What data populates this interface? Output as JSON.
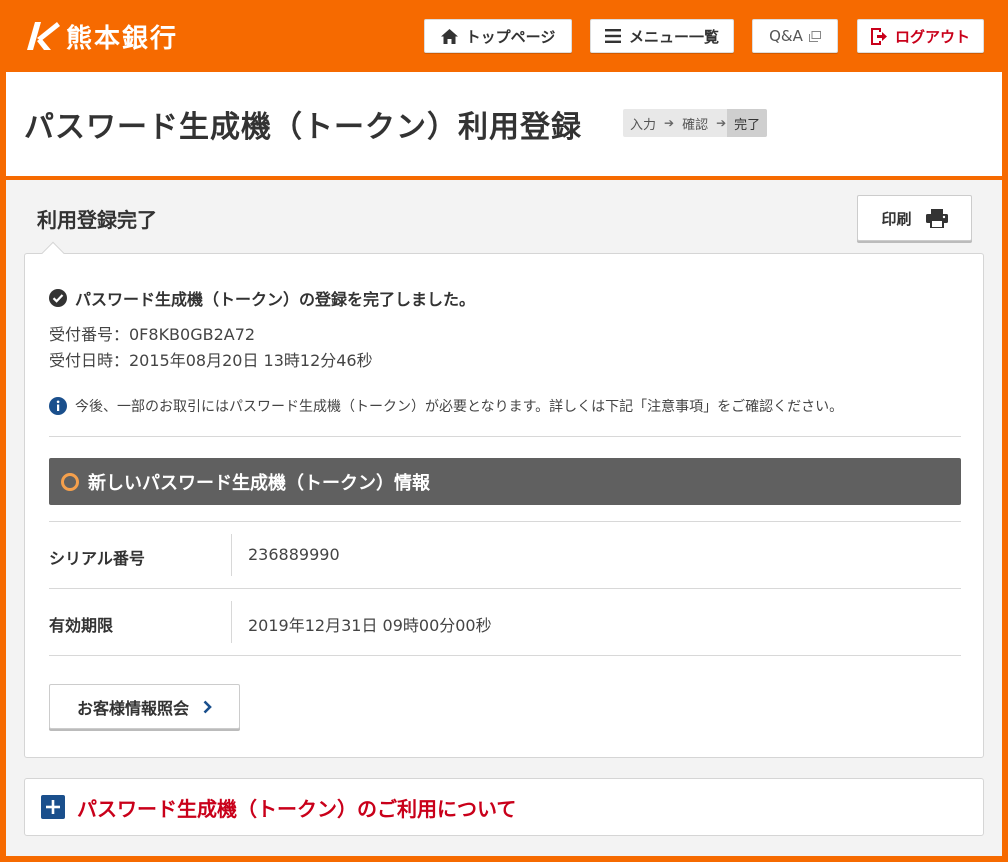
{
  "header": {
    "brand": "熊本銀行",
    "top_page": "トップページ",
    "menu_list": "メニュー一覧",
    "qa": "Q&A",
    "logout": "ログアウト"
  },
  "title": {
    "page_title": "パスワード生成機（トークン）利用登録",
    "steps": [
      "入力",
      "確認",
      "完了"
    ],
    "current_step": "完了"
  },
  "section": {
    "title": "利用登録完了",
    "print": "印刷"
  },
  "result": {
    "done_message": "パスワード生成機（トークン）の登録を完了しました。",
    "receipt_number": "受付番号：0F8KB0GB2A72",
    "receipt_datetime": "受付日時：2015年08月20日 13時12分46秒",
    "info": "今後、一部のお取引にはパスワード生成機（トークン）が必要となります。詳しくは下記「注意事項」をご確認ください。"
  },
  "token_panel": {
    "heading": "新しいパスワード生成機（トークン）情報",
    "rows": [
      {
        "label": "シリアル番号",
        "value": "236889990"
      },
      {
        "label": "有効期限",
        "value": "2019年12月31日 09時00分00秒"
      }
    ]
  },
  "actions": {
    "customer_info": "お客様情報照会"
  },
  "accordion": {
    "label": "パスワード生成機（トークン）のご利用について"
  },
  "colors": {
    "brand_orange": "#f66a00",
    "alert_red": "#c9001a",
    "panel_gray": "#606060",
    "plus_blue": "#1a4f8c"
  }
}
